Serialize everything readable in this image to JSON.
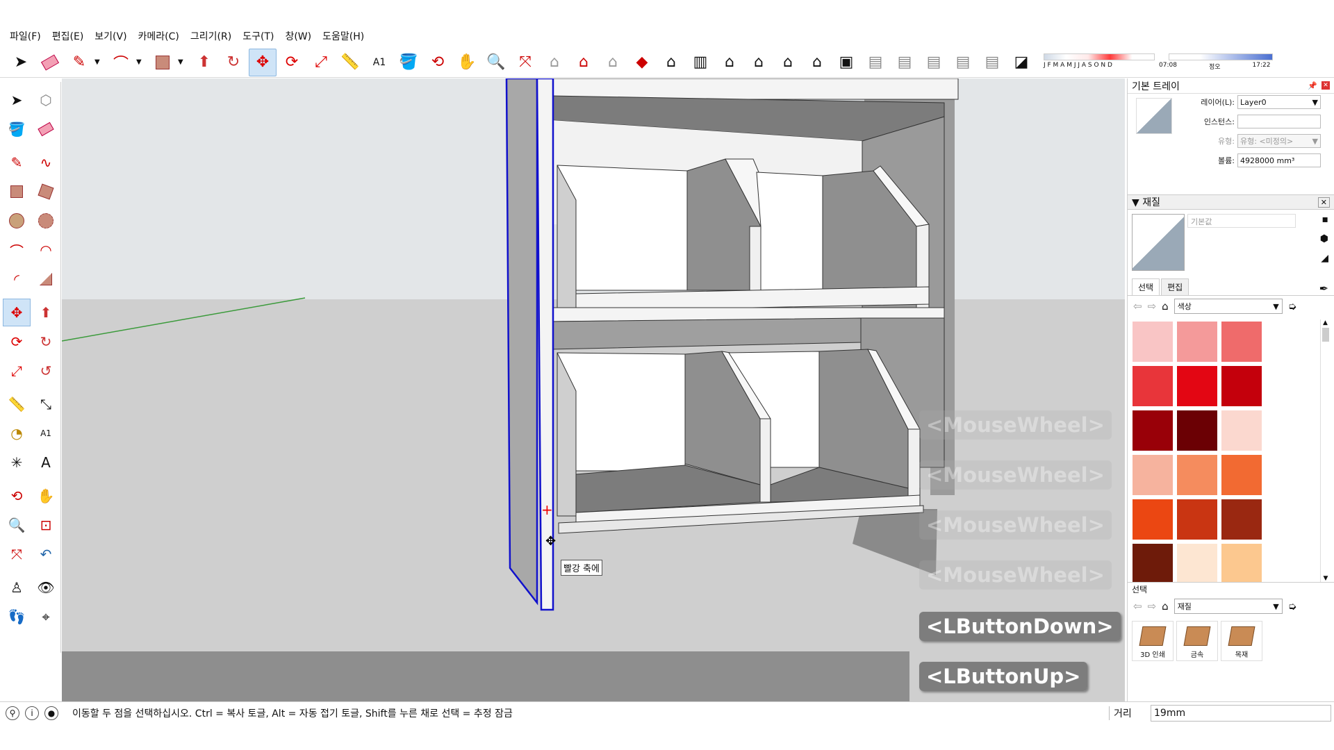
{
  "menu": [
    "파일(F)",
    "편집(E)",
    "보기(V)",
    "카메라(C)",
    "그리기(R)",
    "도구(T)",
    "창(W)",
    "도움말(H)"
  ],
  "toolbar": {
    "icons": [
      "select-icon",
      "eraser-icon",
      "pencil-icon",
      "arc-icon",
      "rectangle-icon",
      "push-pull-icon",
      "follow-me-icon",
      "move-icon",
      "rotate-icon",
      "scale-icon",
      "tape-measure-icon",
      "text-icon",
      "paint-bucket-icon",
      "orbit-icon",
      "pan-icon",
      "zoom-icon",
      "zoom-extents-icon",
      "warehouse-icon",
      "share-model-icon",
      "get-models-icon",
      "ruby-icon",
      "iso-view-icon",
      "front-view-icon",
      "top-view-icon",
      "right-view-icon",
      "back-view-icon",
      "left-view-icon",
      "section-icon",
      "xray-icon",
      "wireframe-icon",
      "hidden-line-icon",
      "shaded-icon",
      "textured-icon",
      "monochrome-icon",
      "shadow-toggle-icon"
    ],
    "shadow_months": "J F M A M J J A S O N D",
    "shadow_time_start": "07:08",
    "shadow_time_mid": "정오",
    "shadow_time_end": "17:22"
  },
  "tray": {
    "title": "기본 트레이",
    "entity": {
      "layer_label": "레이어(L):",
      "layer_value": "Layer0",
      "instance_label": "인스턴스:",
      "instance_value": "",
      "type_label": "유형:",
      "type_value": "유형: <미정의>",
      "volume_label": "볼륨:",
      "volume_value": "4928000 mm³"
    },
    "materials": {
      "title": "재질",
      "name_placeholder": "기본값",
      "tab_select": "선택",
      "tab_edit": "편집",
      "category": "색상",
      "colors": [
        "#f9c5c5",
        "#f49a9a",
        "#ef6b6b",
        "#e8353a",
        "#e30613",
        "#c4000c",
        "#990008",
        "#6b0004",
        "#fbd8cf",
        "#f6b39e",
        "#f58c5e",
        "#f26a32",
        "#eb4712",
        "#c93512",
        "#9a2811",
        "#6e1b0a",
        "#fde6d2",
        "#fcc88f"
      ],
      "secondary_title": "선택",
      "secondary_category": "재질",
      "folders": [
        "3D 인쇄",
        "금속",
        "목재"
      ]
    }
  },
  "overlay": {
    "tooltip": "빨강 축에",
    "keys_faded": [
      "<MouseWheel>",
      "<MouseWheel>",
      "<MouseWheel>",
      "<MouseWheel>"
    ],
    "key_down": "<LButtonDown>",
    "key_up": "<LButtonUp>"
  },
  "status": {
    "message": "이동할 두 점을 선택하십시오. Ctrl = 복사 토글, Alt = 자동 접기 토글, Shift를 누른 채로 선택 = 추정 잠금",
    "measure_label": "거리",
    "measure_value": "19mm"
  }
}
